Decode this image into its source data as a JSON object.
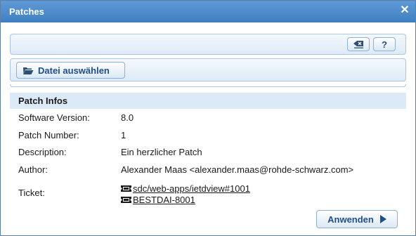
{
  "dialog": {
    "title": "Patches",
    "close_icon": "close-icon"
  },
  "toolbar": {
    "eraser_icon": "eraser-icon",
    "help_label": "?"
  },
  "file": {
    "select_label": "Datei auswählen",
    "icon": "folder-open-icon"
  },
  "patch_info": {
    "header": "Patch Infos",
    "rows": [
      {
        "label": "Software Version:",
        "value": "8.0"
      },
      {
        "label": "Patch Number:",
        "value": "1"
      },
      {
        "label": "Description:",
        "value": "Ein herzlicher Patch"
      },
      {
        "label": "Author:",
        "value": "Alexander Maas <alexander.maas@rohde-schwarz.com>"
      }
    ],
    "ticket_label": "Ticket:",
    "tickets": [
      {
        "text": "sdc/web-apps/ietdview#1001",
        "icon": "ticket-icon"
      },
      {
        "text": "BESTDAI-8001",
        "icon": "ticket-icon"
      }
    ]
  },
  "actions": {
    "apply_label": "Anwenden",
    "apply_icon": "play-icon"
  },
  "colors": {
    "titlebar": "#4a89cb",
    "accent": "#1f4f86",
    "section_bg": "#dceaf7"
  }
}
